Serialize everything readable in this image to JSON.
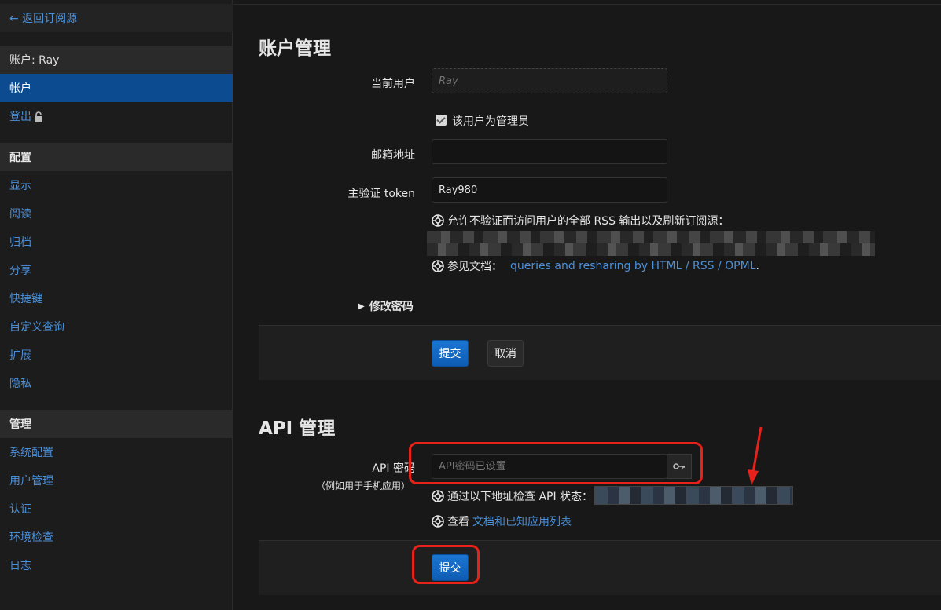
{
  "sidebar": {
    "back_label": "← 返回订阅源",
    "account_header": "账户: Ray",
    "items_account": [
      {
        "label": "帐户",
        "active": true
      },
      {
        "label": "登出"
      }
    ],
    "config_header": "配置",
    "items_config": [
      "显示",
      "阅读",
      "归档",
      "分享",
      "快捷键",
      "自定义查询",
      "扩展",
      "隐私"
    ],
    "admin_header": "管理",
    "items_admin": [
      "系统配置",
      "用户管理",
      "认证",
      "环境检查",
      "日志"
    ]
  },
  "account": {
    "title": "账户管理",
    "current_user_label": "当前用户",
    "current_user_value": "Ray",
    "is_admin_label": "该用户为管理员",
    "is_admin_checked": true,
    "email_label": "邮箱地址",
    "email_value": "",
    "token_label": "主验证 token",
    "token_value": "Ray980",
    "token_help": "允许不验证而访问用户的全部 RSS 输出以及刷新订阅源：",
    "docs_prefix": "参见文档：",
    "docs_link": "queries and resharing by HTML / RSS / OPML",
    "docs_suffix": ".",
    "change_password": "修改密码",
    "submit": "提交",
    "cancel": "取消"
  },
  "api": {
    "title": "API 管理",
    "password_label": "API 密码",
    "password_sublabel": "（例如用于手机应用）",
    "password_placeholder": "API密码已设置",
    "check_help": "通过以下地址检查 API 状态：",
    "view_prefix": "查看",
    "view_link": "文档和已知应用列表",
    "submit": "提交"
  },
  "colors": {
    "accent": "#4a90d9",
    "active_bg": "#0d4b91",
    "highlight": "#e8221a"
  }
}
